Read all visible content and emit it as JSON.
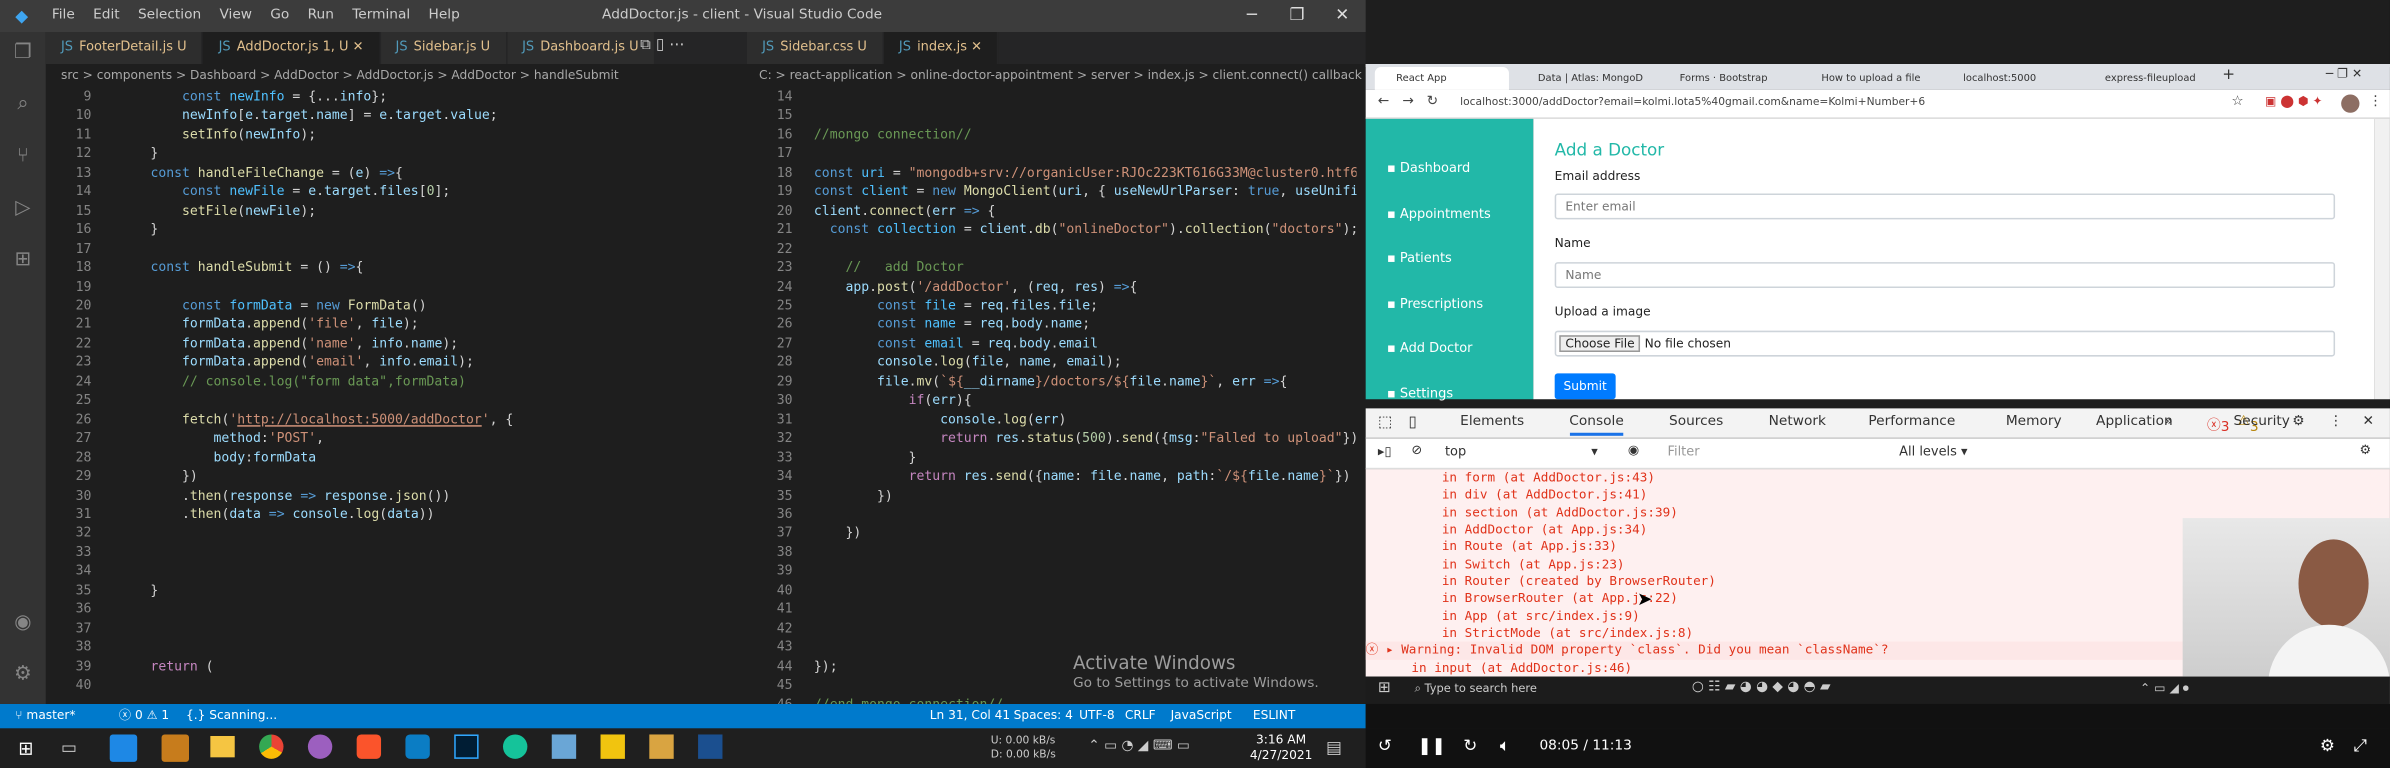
{
  "vscode": {
    "title": "AddDoctor.js - client - Visual Studio Code",
    "menu": [
      "File",
      "Edit",
      "Selection",
      "View",
      "Go",
      "Run",
      "Terminal",
      "Help"
    ],
    "left_tabs": [
      {
        "name": "FooterDetail.js",
        "state": "U"
      },
      {
        "name": "AddDoctor.js",
        "state": "1, U"
      },
      {
        "name": "Sidebar.js",
        "state": "U"
      },
      {
        "name": "Dashboard.js",
        "state": "U"
      }
    ],
    "right_tabs": [
      {
        "name": "Sidebar.css",
        "state": "U"
      },
      {
        "name": "index.js",
        "state": ""
      }
    ],
    "left_breadcrumb": [
      "src",
      ">",
      "components",
      ">",
      "Dashboard",
      ">",
      "AddDoctor",
      ">",
      "AddDoctor.js",
      ">",
      "AddDoctor",
      ">",
      "handleSubmit"
    ],
    "right_breadcrumb": [
      "C:",
      ">",
      "react-application",
      ">",
      "online-doctor-appointment",
      ">",
      "server",
      ">",
      "index.js",
      ">",
      "client.connect() callback"
    ],
    "left_lines": [
      "9",
      "10",
      "11",
      "12",
      "13",
      "14",
      "15",
      "16",
      "17",
      "18",
      "19",
      "20",
      "21",
      "22",
      "23",
      "24",
      "25",
      "26",
      "27",
      "28",
      "29",
      "30",
      "31",
      "32",
      "33",
      "34",
      "35",
      "36",
      "37",
      "38",
      "39",
      "40"
    ],
    "right_lines": [
      "14",
      "15",
      "16",
      "17",
      "18",
      "19",
      "20",
      "21",
      "22",
      "23",
      "24",
      "25",
      "26",
      "27",
      "28",
      "29",
      "30",
      "31",
      "32",
      "33",
      "34",
      "35",
      "36",
      "37",
      "38",
      "39",
      "40",
      "41",
      "42",
      "43",
      "44",
      "45",
      "46"
    ],
    "activate_title": "Activate Windows",
    "activate_sub": "Go to Settings to activate Windows.",
    "status": {
      "branch": "master*",
      "errors": "0",
      "warnings": "1",
      "scanning": "{.} Scanning...",
      "position": "Ln 31, Col 41",
      "spaces": "Spaces: 4",
      "encoding": "UTF-8",
      "eol": "CRLF",
      "lang": "JavaScript",
      "eslint": "ESLINT"
    },
    "colors": {
      "accent": "#007acc",
      "titlebar": "#3c3c3c"
    }
  },
  "chrome": {
    "tabs": [
      "React App",
      "Data | Atlas: MongoD",
      "Forms · Bootstrap",
      "How to upload a file",
      "localhost:5000",
      "express-fileupload"
    ],
    "url": "localhost:3000/addDoctor?email=kolmi.lota5%40gmail.com&name=Kolmi+Number+6"
  },
  "app": {
    "sidebar": [
      "Dashboard",
      "Appointments",
      "Patients",
      "Prescriptions",
      "Add Doctor",
      "Settings"
    ],
    "form_title": "Add a Doctor",
    "email_label": "Email address",
    "email_placeholder": "Enter email",
    "name_label": "Name",
    "name_placeholder": "Name",
    "upload_label": "Upload a image",
    "choose_file": "Choose File",
    "no_file": "No file chosen",
    "submit": "Submit",
    "accent": "#22b8a8"
  },
  "devtools": {
    "tabs": [
      "Elements",
      "Console",
      "Sources",
      "Network",
      "Performance",
      "Memory",
      "Application",
      "Security"
    ],
    "active": "Console",
    "errors": "3",
    "warnings": "3",
    "context": "top",
    "filter_placeholder": "Filter",
    "levels": "All levels",
    "lines": [
      " in form (at AddDoctor.js:43)",
      " in div (at AddDoctor.js:41)",
      " in section (at AddDoctor.js:39)",
      " in AddDoctor (at App.js:34)",
      " in Route (at App.js:33)",
      " in Switch (at App.js:23)",
      " in Router (created by BrowserRouter)",
      " in BrowserRouter (at App.js:22)",
      " in App (at src/index.js:9)",
      " in StrictMode (at src/index.js:8)"
    ],
    "warning": "Warning: Invalid DOM property `class`. Did you mean `className`?",
    "warning_sub": " in input (at AddDoctor.js:46)"
  },
  "windows": {
    "search": "Type to search here",
    "time": "3:16 AM",
    "date": "4/27/2021",
    "net_up": "0.00 kB/s",
    "net_down": "0.00 kB/s",
    "net_u": "U:",
    "net_d": "D:"
  },
  "player": {
    "time": "08:05 / 11:13"
  }
}
